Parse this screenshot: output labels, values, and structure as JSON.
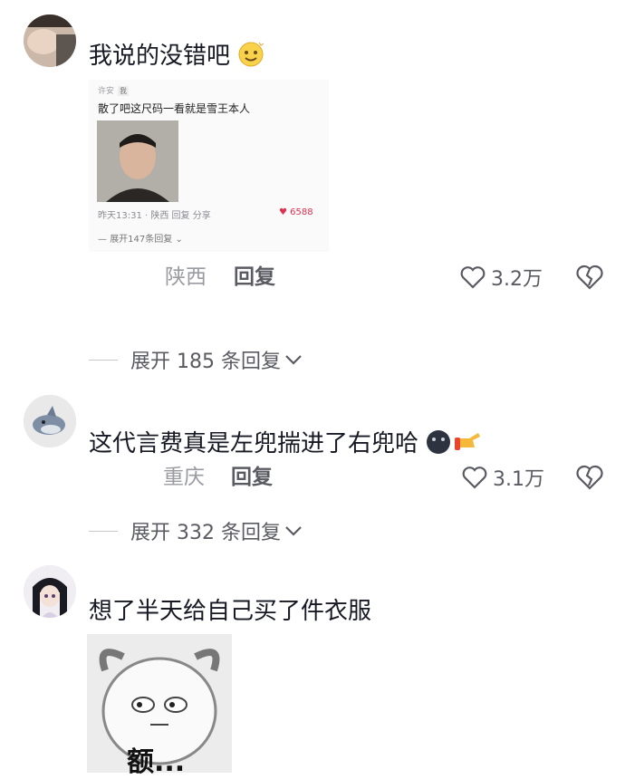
{
  "comments": [
    {
      "text": "我说的没错吧",
      "emoji": "smiling-face-icon",
      "location": "陕西",
      "reply_label": "回复",
      "likes": "3.2万",
      "expand_label": "展开 185 条回复",
      "embedded": {
        "username": "许安",
        "badge": "我",
        "text": "散了吧这尺码一看就是雪王本人",
        "meta": "昨天13:31 · 陕西    回复      分享",
        "likes": "6588",
        "expand": "展开147条回复"
      }
    },
    {
      "text": "这代言费真是左兜揣进了右兜哈",
      "emoji": "dark-face-and-pointing-hand-icon",
      "location": "重庆",
      "reply_label": "回复",
      "likes": "3.1万",
      "expand_label": "展开 332 条回复"
    },
    {
      "text": "想了半天给自己买了件衣服",
      "sticker_caption": "额..."
    }
  ]
}
